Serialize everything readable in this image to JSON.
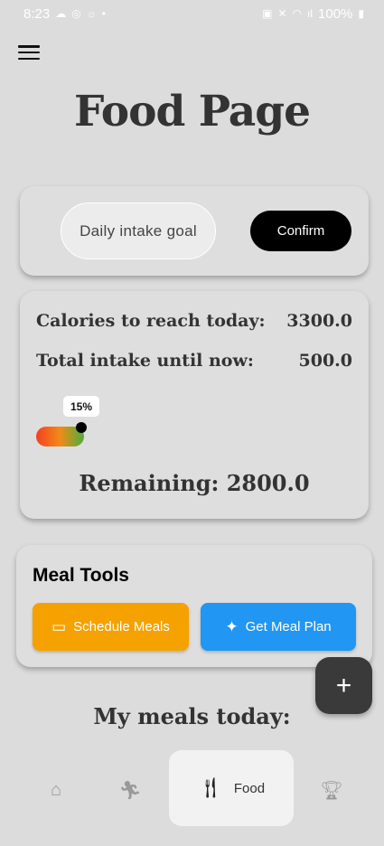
{
  "status_bar": {
    "time": "8:23",
    "battery": "100%"
  },
  "header": {
    "title": "Food Page"
  },
  "goal": {
    "input_placeholder": "Daily intake goal",
    "confirm_label": "Confirm"
  },
  "calories": {
    "target_label": "Calories to reach today:",
    "target_value": "3300.0",
    "intake_label": "Total intake until now:",
    "intake_value": "500.0",
    "progress_label": "15%",
    "progress_fraction": 0.15,
    "remaining_text": "Remaining: 2800.0"
  },
  "meal_tools": {
    "title": "Meal Tools",
    "schedule_label": "Schedule Meals",
    "plan_label": "Get Meal Plan",
    "schedule_color": "#f5a200",
    "plan_color": "#2196f3"
  },
  "meals": {
    "heading": "My meals today:"
  },
  "fab": {
    "icon": "plus-icon"
  },
  "nav": {
    "items": [
      {
        "icon": "home-icon"
      },
      {
        "icon": "run-icon"
      },
      {
        "icon": "food-icon",
        "label": "Food",
        "active": true
      },
      {
        "icon": "trophy-icon"
      }
    ]
  }
}
